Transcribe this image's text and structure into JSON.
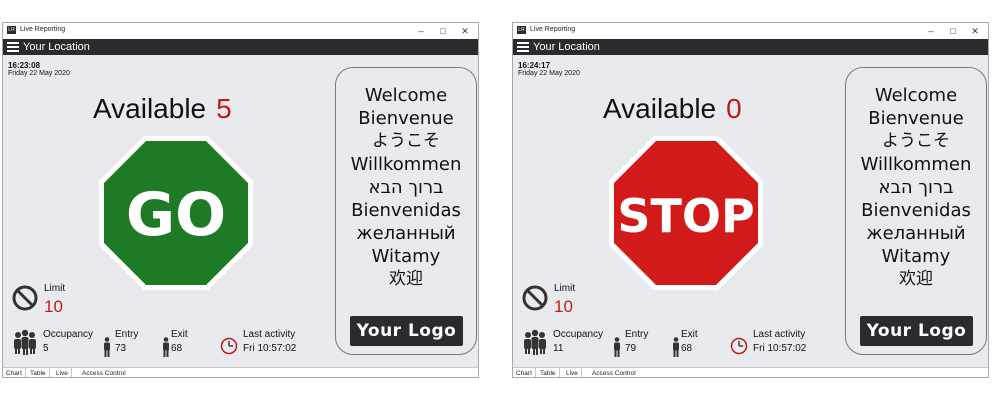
{
  "windows": [
    {
      "title": "Live Reporting",
      "location": "Your Location",
      "time": "16:23:08",
      "date": "Friday 22 May 2020",
      "available_label": "Available",
      "available_count": "5",
      "sign_text": "GO",
      "sign_color": "#1e7a24",
      "limit_label": "Limit",
      "limit_value": "10",
      "occupancy_label": "Occupancy",
      "occupancy_value": "5",
      "entry_label": "Entry",
      "entry_value": "73",
      "exit_label": "Exit",
      "exit_value": "68",
      "activity_label": "Last activity",
      "activity_value": "Fri 10:57:02",
      "greetings": [
        "Welcome",
        "Bienvenue",
        "ようこそ",
        "Willkommen",
        "ברוך הבא",
        "Bienvenidas",
        "желанный",
        "Witamy",
        "欢迎"
      ],
      "logo_label": "Your Logo",
      "tabs": [
        "Chart",
        "Table",
        "Live",
        "Access Control"
      ]
    },
    {
      "title": "Live Reporting",
      "location": "Your Location",
      "time": "16:24:17",
      "date": "Friday 22 May 2020",
      "available_label": "Available",
      "available_count": "0",
      "sign_text": "STOP",
      "sign_color": "#d21a1a",
      "limit_label": "Limit",
      "limit_value": "10",
      "occupancy_label": "Occupancy",
      "occupancy_value": "11",
      "entry_label": "Entry",
      "entry_value": "79",
      "exit_label": "Exit",
      "exit_value": "68",
      "activity_label": "Last activity",
      "activity_value": "Fri 10:57:02",
      "greetings": [
        "Welcome",
        "Bienvenue",
        "ようこそ",
        "Willkommen",
        "ברוך הבא",
        "Bienvenidas",
        "желанный",
        "Witamy",
        "欢迎"
      ],
      "logo_label": "Your Logo",
      "tabs": [
        "Chart",
        "Table",
        "Live",
        "Access Control"
      ]
    }
  ],
  "colors": {
    "accent_red": "#c01b1b",
    "app_bar": "#2b2b2f",
    "panel_bg": "#e9eaee"
  },
  "icons": {
    "limit": "prohibited-icon",
    "occupancy": "people-group-icon",
    "entry": "person-icon",
    "exit": "person-icon",
    "activity": "clock-icon"
  }
}
